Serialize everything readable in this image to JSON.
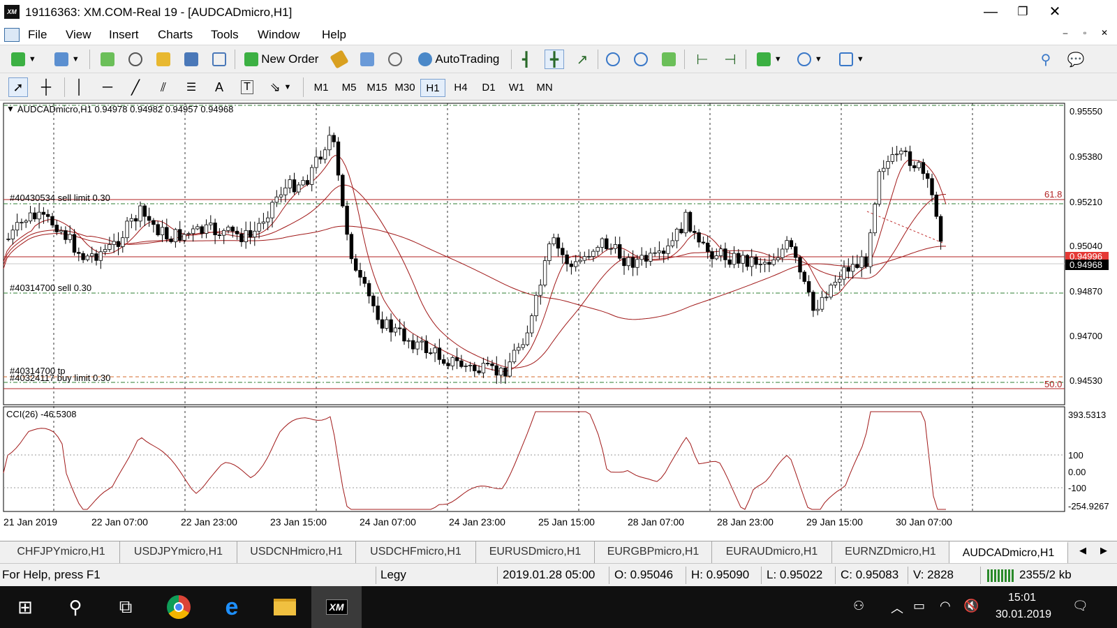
{
  "window": {
    "title": "19116363: XM.COM-Real 19 - [AUDCADmicro,H1]",
    "logo": "XM",
    "controls": {
      "minimize": "—",
      "restore": "❐",
      "close": "✕"
    },
    "mdi_controls": {
      "minimize": "–",
      "restore": "▫",
      "close": "✕"
    }
  },
  "menu": [
    "File",
    "View",
    "Insert",
    "Charts",
    "Tools",
    "Window",
    "Help"
  ],
  "toolbar": {
    "new_order": "New Order",
    "autotrading": "AutoTrading"
  },
  "timeframes": [
    "M1",
    "M5",
    "M15",
    "M30",
    "H1",
    "H4",
    "D1",
    "W1",
    "MN"
  ],
  "active_timeframe": "H1",
  "chart": {
    "info": "AUDCADmicro,H1  0.94978 0.94982 0.94957 0.94968",
    "symbol": "AUDCADmicro",
    "ohlc": {
      "open": 0.94978,
      "high": 0.94982,
      "low": 0.94957,
      "close": 0.94968
    },
    "price_ticks": [
      "0.95550",
      "0.95380",
      "0.95210",
      "0.95040",
      "0.94870",
      "0.94700",
      "0.94530"
    ],
    "bid_label": "0.94968",
    "ask_label": "0.94996",
    "order_labels": {
      "sell_limit": "#40430534 sell limit 0.30",
      "sell": "#40314700 sell 0.30",
      "tp": "#40314700 tp",
      "buy_limit": "#40324117 buy limit 0.30"
    },
    "fib_labels": {
      "f618": "61.8",
      "f500": "50.0"
    },
    "time_labels": [
      "21 Jan 2019",
      "22 Jan 07:00",
      "22 Jan 23:00",
      "23 Jan 15:00",
      "24 Jan 07:00",
      "24 Jan 23:00",
      "25 Jan 15:00",
      "28 Jan 07:00",
      "28 Jan 23:00",
      "29 Jan 15:00",
      "30 Jan 07:00"
    ],
    "colors": {
      "candle": "#000000",
      "ma": "#a01818",
      "order_line": "#2e7d32",
      "level_line": "#b22222",
      "bid_bg": "#000000",
      "ask_bg": "#e53935"
    }
  },
  "indicator": {
    "label": "CCI(26) -46.5308",
    "ticks": [
      "393.5313",
      "100",
      "0.00",
      "-100",
      "-254.9267"
    ]
  },
  "tabs": [
    "CHFJPYmicro,H1",
    "USDJPYmicro,H1",
    "USDCNHmicro,H1",
    "USDCHFmicro,H1",
    "EURUSDmicro,H1",
    "EURGBPmicro,H1",
    "EURAUDmicro,H1",
    "EURNZDmicro,H1",
    "AUDCADmicro,H1"
  ],
  "active_tab": "AUDCADmicro,H1",
  "status": {
    "help": "For Help, press F1",
    "profile": "Legy",
    "datetime": "2019.01.28 05:00",
    "open": "O: 0.95046",
    "high": "H: 0.95090",
    "low": "L: 0.95022",
    "close": "C: 0.95083",
    "volume": "V: 2828",
    "traffic": "2355/2 kb"
  },
  "taskbar": {
    "time": "15:01",
    "date": "30.01.2019"
  }
}
